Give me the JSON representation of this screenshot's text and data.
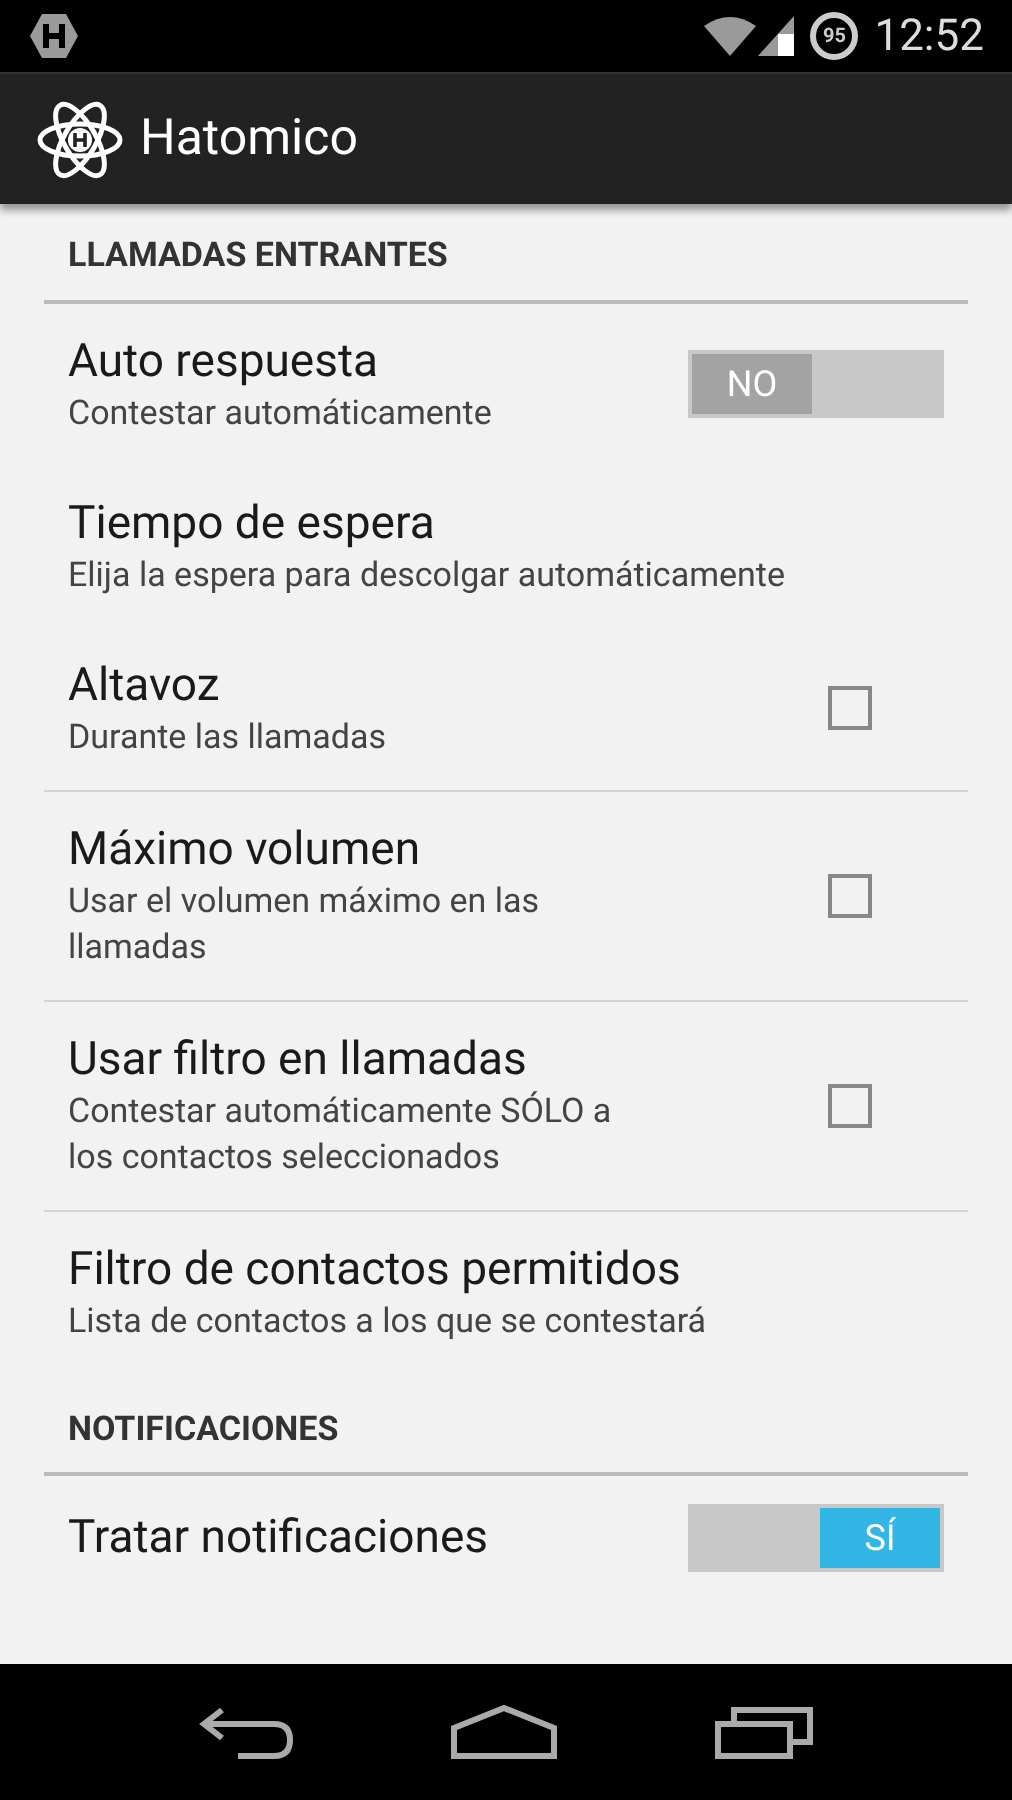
{
  "status_bar": {
    "battery": "95",
    "time": "12:52"
  },
  "action_bar": {
    "title": "Hatomico"
  },
  "sections": [
    {
      "header": "LLAMADAS ENTRANTES",
      "items": [
        {
          "kind": "toggle",
          "title": "Auto respuesta",
          "summary": "Contestar automáticamente",
          "on": false,
          "switch_label": "NO"
        },
        {
          "kind": "plain",
          "title": "Tiempo de espera",
          "summary": "Elija la espera para descolgar automáticamente"
        },
        {
          "kind": "checkbox",
          "title": "Altavoz",
          "summary": "Durante las llamadas",
          "checked": false
        },
        {
          "kind": "checkbox",
          "title": "Máximo volumen",
          "summary": "Usar el volumen máximo en las llamadas",
          "checked": false
        },
        {
          "kind": "checkbox",
          "title": "Usar filtro en llamadas",
          "summary": "Contestar automáticamente SÓLO a los contactos seleccionados",
          "checked": false
        },
        {
          "kind": "plain",
          "title": "Filtro de contactos permitidos",
          "summary": "Lista de contactos a los que se contestará"
        }
      ]
    },
    {
      "header": "NOTIFICACIONES",
      "items": [
        {
          "kind": "toggle",
          "title": "Tratar notificaciones",
          "on": true,
          "switch_label": "SÍ"
        }
      ]
    }
  ]
}
